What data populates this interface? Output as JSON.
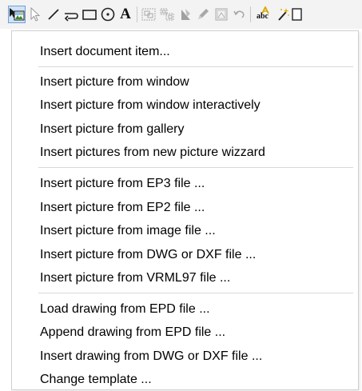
{
  "toolbar": {
    "tools": [
      {
        "icon": "insert-picture-icon",
        "state": "active"
      },
      {
        "icon": "select-arrow-icon"
      },
      {
        "icon": "line-icon"
      },
      {
        "icon": "polyline-icon"
      },
      {
        "icon": "rectangle-icon"
      },
      {
        "icon": "circle-icon"
      },
      {
        "icon": "text-icon",
        "glyph": "A"
      },
      {
        "icon": "group-icon"
      },
      {
        "icon": "ungroup-icon"
      },
      {
        "icon": "fill-icon"
      },
      {
        "icon": "pen-icon"
      },
      {
        "icon": "image-frame-icon"
      },
      {
        "icon": "undo-icon"
      },
      {
        "icon": "spell-check-icon",
        "glyph": "abc"
      },
      {
        "icon": "magic-wand-icon"
      },
      {
        "icon": "page-icon"
      }
    ]
  },
  "menu": {
    "items": [
      "Insert document item...",
      "Insert picture from window",
      "Insert picture from window interactively",
      "Insert picture from gallery",
      "Insert pictures from new picture wizzard",
      "Insert picture from EP3 file ...",
      "Insert picture from EP2 file ...",
      "Insert picture from image file ...",
      "Insert picture from DWG or DXF file ...",
      "Insert picture from VRML97 file ...",
      "Load drawing from EPD file ...",
      "Append drawing from EPD file ...",
      "Insert drawing from DWG or DXF file ...",
      "Change template ..."
    ]
  }
}
